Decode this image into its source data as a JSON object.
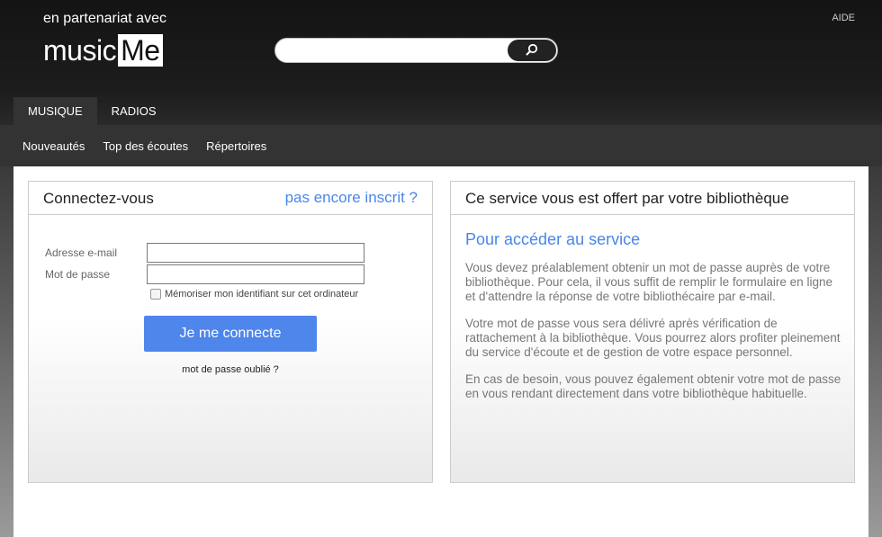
{
  "header": {
    "partner_text": "en partenariat avec",
    "logo_music": "music",
    "logo_me": "Me",
    "search": {
      "value": "",
      "placeholder": ""
    },
    "help_link": "AIDE"
  },
  "tabs": [
    {
      "label": "MUSIQUE",
      "active": true
    },
    {
      "label": "RADIOS",
      "active": false
    }
  ],
  "subnav": [
    {
      "label": "Nouveautés"
    },
    {
      "label": "Top des écoutes"
    },
    {
      "label": "Répertoires"
    }
  ],
  "login": {
    "title": "Connectez-vous",
    "register_link": "pas encore inscrit ?",
    "email_label": "Adresse e-mail",
    "email_value": "",
    "password_label": "Mot de passe",
    "password_value": "",
    "remember_label": "Mémoriser mon identifiant sur cet ordinateur",
    "remember_checked": false,
    "submit_label": "Je me connecte",
    "forgot_link": "mot de passe oublié ?"
  },
  "service": {
    "title": "Ce service vous est offert par votre bibliothèque",
    "heading": "Pour accéder au service",
    "paragraphs": [
      "Vous devez préalablement obtenir un mot de passe auprès de votre bibliothèque. Pour cela, il vous suffit de remplir le formulaire en ligne et d'attendre la réponse de votre bibliothécaire par e-mail.",
      "Votre mot de passe vous sera délivré après vérification de rattachement à la bibliothèque. Vous pourrez alors profiter pleinement du service d'écoute et de gestion de votre espace personnel.",
      "En cas de besoin, vous pouvez également obtenir votre mot de passe en vous rendant directement dans votre bibliothèque habituelle."
    ]
  },
  "colors": {
    "accent": "#4a86e8",
    "button": "#4f86ec",
    "nav_active": "#333333"
  }
}
